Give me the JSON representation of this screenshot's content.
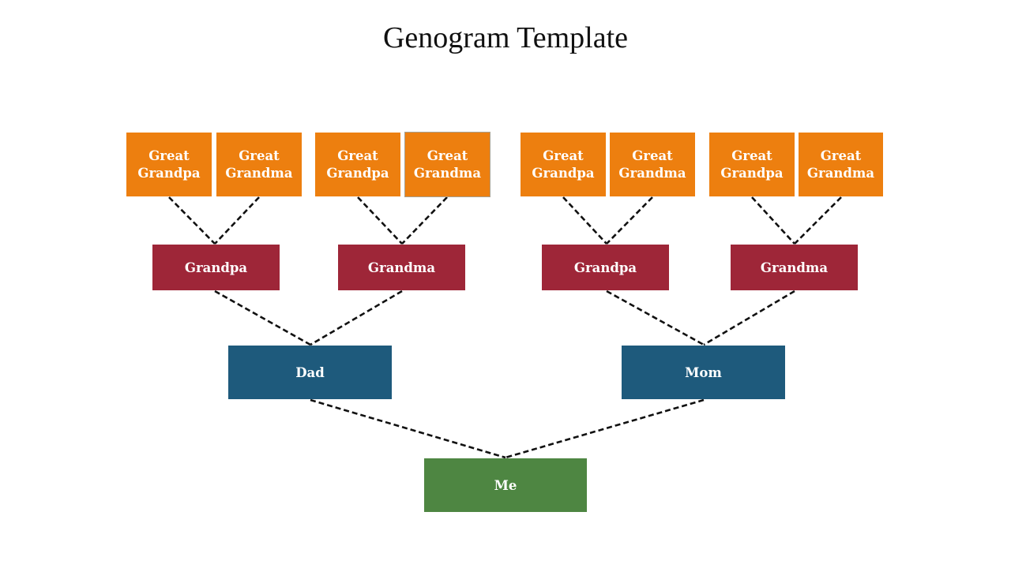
{
  "title": "Genogram Template",
  "colors": {
    "great_grandparent": "#ED7F0F",
    "grandparent": "#9E2638",
    "parent": "#1E5A7C",
    "me": "#4E8642",
    "connector": "#111111"
  },
  "great_grandparents": [
    {
      "label": "Great\nGrandpa"
    },
    {
      "label": "Great\nGrandma"
    },
    {
      "label": "Great\nGrandpa"
    },
    {
      "label": "Great\nGrandma"
    },
    {
      "label": "Great\nGrandpa"
    },
    {
      "label": "Great\nGrandma"
    },
    {
      "label": "Great\nGrandpa"
    },
    {
      "label": "Great\nGrandma"
    }
  ],
  "grandparents": [
    {
      "label": "Grandpa"
    },
    {
      "label": "Grandma"
    },
    {
      "label": "Grandpa"
    },
    {
      "label": "Grandma"
    }
  ],
  "parents": [
    {
      "label": "Dad"
    },
    {
      "label": "Mom"
    }
  ],
  "me": {
    "label": "Me"
  }
}
